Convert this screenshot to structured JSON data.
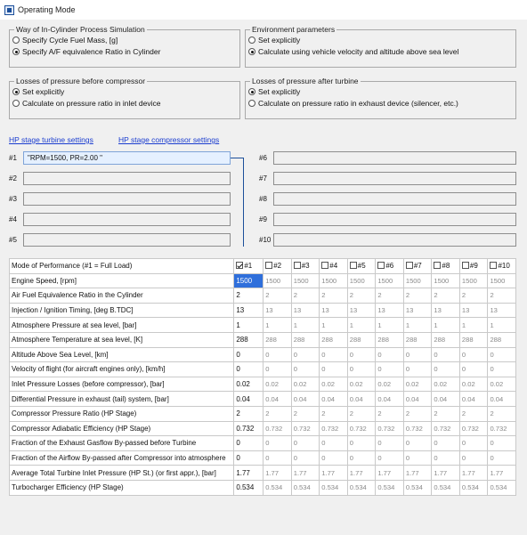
{
  "window": {
    "title": "Operating Mode"
  },
  "cylinder_sim": {
    "legend": "Way of In-Cylinder Process Simulation",
    "options": [
      "Specify Cycle Fuel Mass, [g]",
      "Specify A/F equivalence Ratio in Cylinder"
    ],
    "selected": 1
  },
  "environment": {
    "legend": "Environment parameters",
    "options": [
      "Set explicitly",
      "Calculate using vehicle velocity and altitude above sea level"
    ],
    "selected": 1
  },
  "losses_before": {
    "legend": "Losses of pressure before compressor",
    "options": [
      "Set explicitly",
      "Calculate on pressure ratio in inlet device"
    ],
    "selected": 0
  },
  "losses_after": {
    "legend": "Losses of pressure after turbine",
    "options": [
      "Set explicitly",
      "Calculate on pressure ratio in exhaust device (silencer, etc.)"
    ],
    "selected": 0
  },
  "links": {
    "turbine": "HP stage turbine settings",
    "compressor": "HP stage compressor settings"
  },
  "stages": {
    "left": [
      {
        "label": "#1",
        "value": "\"RPM=1500, PR=2.00  \""
      },
      {
        "label": "#2",
        "value": ""
      },
      {
        "label": "#3",
        "value": ""
      },
      {
        "label": "#4",
        "value": ""
      },
      {
        "label": "#5",
        "value": ""
      }
    ],
    "right": [
      {
        "label": "#6",
        "value": ""
      },
      {
        "label": "#7",
        "value": ""
      },
      {
        "label": "#8",
        "value": ""
      },
      {
        "label": "#9",
        "value": ""
      },
      {
        "label": "#10",
        "value": ""
      }
    ]
  },
  "grid": {
    "header_label": "Mode of Performance (#1 = Full Load)",
    "modes": [
      "#1",
      "#2",
      "#3",
      "#4",
      "#5",
      "#6",
      "#7",
      "#8",
      "#9",
      "#10"
    ],
    "checked": [
      true,
      false,
      false,
      false,
      false,
      false,
      false,
      false,
      false,
      false
    ],
    "selection_color": "#2f6fdb",
    "rows": [
      {
        "label": "Engine Speed, [rpm]",
        "values": [
          "1500",
          "1500",
          "1500",
          "1500",
          "1500",
          "1500",
          "1500",
          "1500",
          "1500",
          "1500"
        ]
      },
      {
        "label": "Air Fuel Equivalence Ratio in the Cylinder",
        "values": [
          "2",
          "2",
          "2",
          "2",
          "2",
          "2",
          "2",
          "2",
          "2",
          "2"
        ]
      },
      {
        "label": "Injection / Ignition Timing, [deg B.TDC]",
        "values": [
          "13",
          "13",
          "13",
          "13",
          "13",
          "13",
          "13",
          "13",
          "13",
          "13"
        ]
      },
      {
        "label": "Atmosphere Pressure at sea level, [bar]",
        "values": [
          "1",
          "1",
          "1",
          "1",
          "1",
          "1",
          "1",
          "1",
          "1",
          "1"
        ]
      },
      {
        "label": "Atmosphere Temperature at sea level, [K]",
        "values": [
          "288",
          "288",
          "288",
          "288",
          "288",
          "288",
          "288",
          "288",
          "288",
          "288"
        ]
      },
      {
        "label": "Altitude Above Sea Level, [km]",
        "values": [
          "0",
          "0",
          "0",
          "0",
          "0",
          "0",
          "0",
          "0",
          "0",
          "0"
        ]
      },
      {
        "label": "Velocity of flight (for aircraft engines only), [km/h]",
        "values": [
          "0",
          "0",
          "0",
          "0",
          "0",
          "0",
          "0",
          "0",
          "0",
          "0"
        ]
      },
      {
        "label": "Inlet Pressure Losses (before compressor), [bar]",
        "values": [
          "0.02",
          "0.02",
          "0.02",
          "0.02",
          "0.02",
          "0.02",
          "0.02",
          "0.02",
          "0.02",
          "0.02"
        ]
      },
      {
        "label": "Differential Pressure in exhaust (tail) system, [bar]",
        "values": [
          "0.04",
          "0.04",
          "0.04",
          "0.04",
          "0.04",
          "0.04",
          "0.04",
          "0.04",
          "0.04",
          "0.04"
        ]
      },
      {
        "label": "Compressor Pressure Ratio (HP Stage)",
        "values": [
          "2",
          "2",
          "2",
          "2",
          "2",
          "2",
          "2",
          "2",
          "2",
          "2"
        ]
      },
      {
        "label": "Compressor Adiabatic Efficiency (HP Stage)",
        "values": [
          "0.732",
          "0.732",
          "0.732",
          "0.732",
          "0.732",
          "0.732",
          "0.732",
          "0.732",
          "0.732",
          "0.732"
        ]
      },
      {
        "label": "Fraction of the Exhaust Gasflow By-passed before Turbine",
        "values": [
          "0",
          "0",
          "0",
          "0",
          "0",
          "0",
          "0",
          "0",
          "0",
          "0"
        ]
      },
      {
        "label": "Fraction of the Airflow By-passed after Compressor into atmosphere",
        "values": [
          "0",
          "0",
          "0",
          "0",
          "0",
          "0",
          "0",
          "0",
          "0",
          "0"
        ]
      },
      {
        "label": "Average Total Turbine Inlet Pressure (HP St.) (or first appr.), [bar]",
        "values": [
          "1.77",
          "1.77",
          "1.77",
          "1.77",
          "1.77",
          "1.77",
          "1.77",
          "1.77",
          "1.77",
          "1.77"
        ]
      },
      {
        "label": "Turbocharger Efficiency (HP Stage)",
        "values": [
          "0.534",
          "0.534",
          "0.534",
          "0.534",
          "0.534",
          "0.534",
          "0.534",
          "0.534",
          "0.534",
          "0.534"
        ]
      }
    ]
  }
}
